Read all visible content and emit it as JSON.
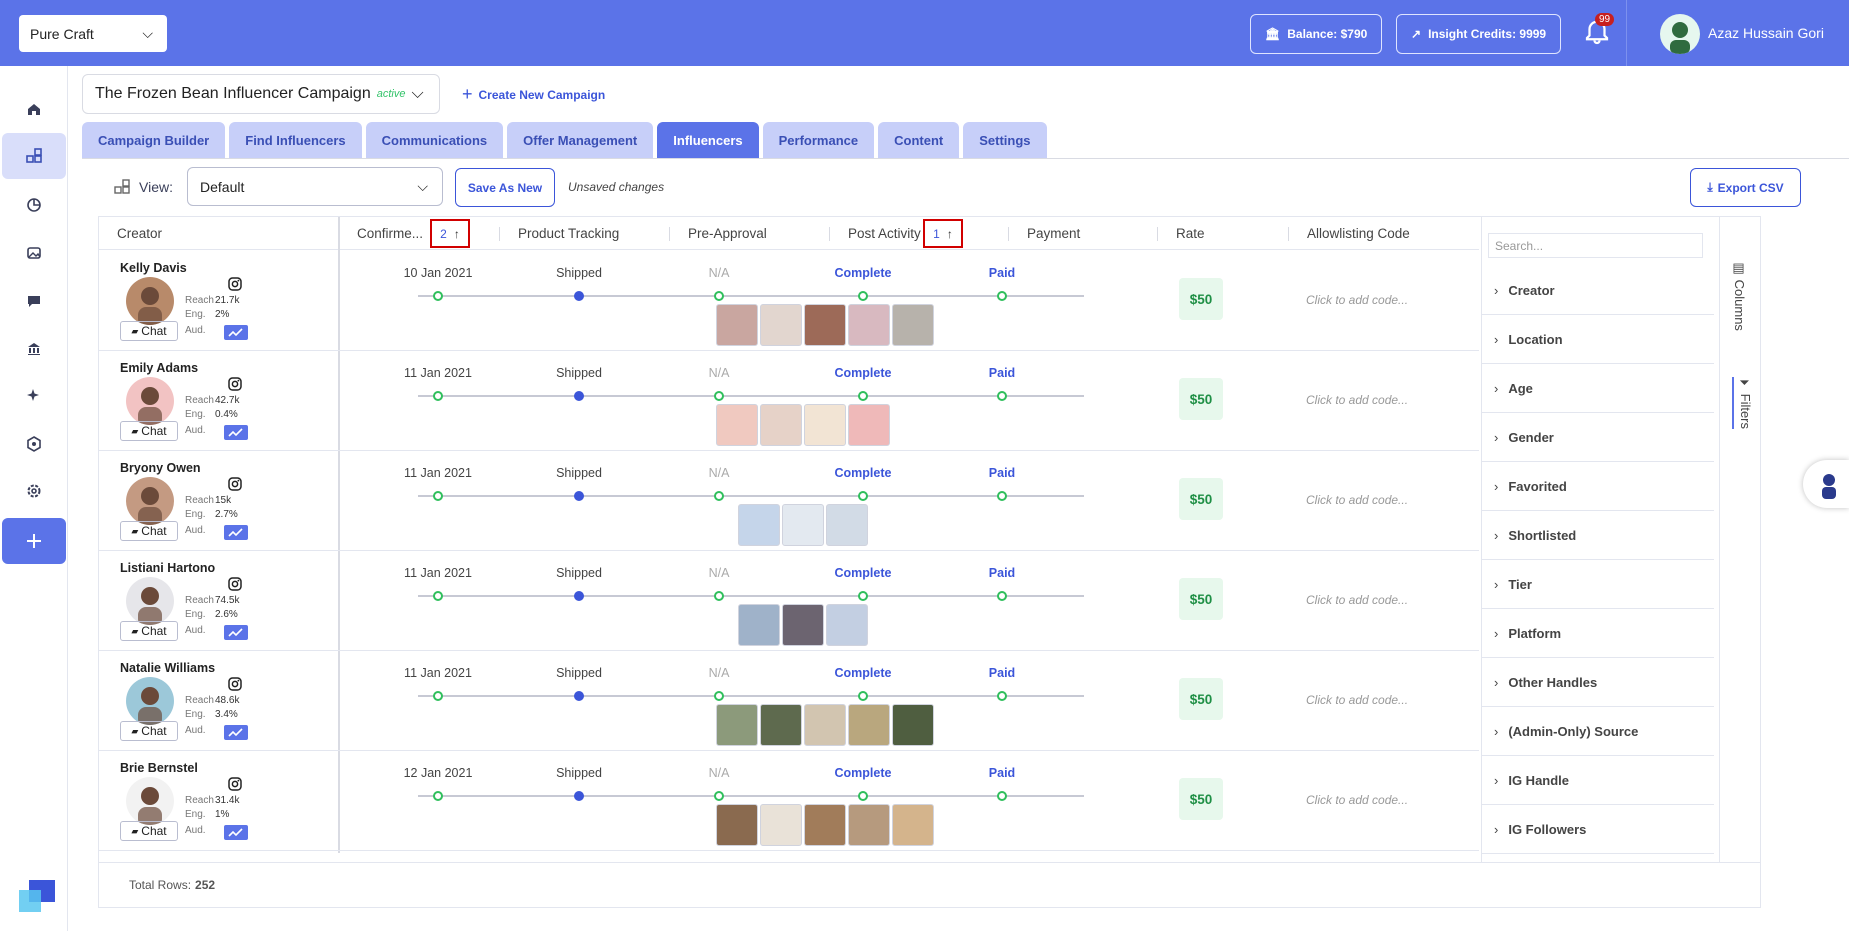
{
  "topbar": {
    "org": "Pure Craft",
    "balance": "Balance: $790",
    "credits": "Insight Credits: 9999",
    "notif_count": "99",
    "user": "Azaz Hussain Gori",
    "color": "#5b73e8"
  },
  "sidebar": {
    "items": [
      "home-icon",
      "dashboard-icon",
      "analytics-icon",
      "media-icon",
      "chat-icon",
      "bank-icon",
      "sparkle-icon",
      "shield-icon",
      "gear-icon",
      "plus-icon"
    ]
  },
  "campaign": {
    "name": "The Frozen Bean Influencer Campaign",
    "status": "active",
    "create_new": "Create New Campaign"
  },
  "tabs": [
    "Campaign Builder",
    "Find Influencers",
    "Communications",
    "Offer Management",
    "Influencers",
    "Performance",
    "Content",
    "Settings"
  ],
  "toolbar": {
    "view_label": "View:",
    "view_value": "Default",
    "save_as_new": "Save As New",
    "unsaved": "Unsaved changes",
    "export": "Export CSV"
  },
  "columns": {
    "creator": "Creator",
    "confirmed": "Confirme...",
    "confirmed_sort": "2",
    "product_tracking": "Product Tracking",
    "pre_approval": "Pre-Approval",
    "post_activity": "Post Activity",
    "post_activity_sort": "1",
    "payment": "Payment",
    "rate": "Rate",
    "allowlisting": "Allowlisting Code"
  },
  "labels": {
    "reach": "Reach",
    "eng": "Eng.",
    "aud": "Aud.",
    "chat": "Chat"
  },
  "rows": [
    {
      "name": "Kelly Davis",
      "reach": "21.7k",
      "eng": "2%",
      "date": "10 Jan 2021",
      "tracking": "Shipped",
      "pre": "N/A",
      "post": "Complete",
      "payment": "Paid",
      "rate": "$50",
      "code": "Click to add code..."
    },
    {
      "name": "Emily Adams",
      "reach": "42.7k",
      "eng": "0.4%",
      "date": "11 Jan 2021",
      "tracking": "Shipped",
      "pre": "N/A",
      "post": "Complete",
      "payment": "Paid",
      "rate": "$50",
      "code": "Click to add code..."
    },
    {
      "name": "Bryony Owen",
      "reach": "15k",
      "eng": "2.7%",
      "date": "11 Jan 2021",
      "tracking": "Shipped",
      "pre": "N/A",
      "post": "Complete",
      "payment": "Paid",
      "rate": "$50",
      "code": "Click to add code..."
    },
    {
      "name": "Listiani Hartono",
      "reach": "74.5k",
      "eng": "2.6%",
      "date": "11 Jan 2021",
      "tracking": "Shipped",
      "pre": "N/A",
      "post": "Complete",
      "payment": "Paid",
      "rate": "$50",
      "code": "Click to add code..."
    },
    {
      "name": "Natalie Williams",
      "reach": "48.6k",
      "eng": "3.4%",
      "date": "11 Jan 2021",
      "tracking": "Shipped",
      "pre": "N/A",
      "post": "Complete",
      "payment": "Paid",
      "rate": "$50",
      "code": "Click to add code..."
    },
    {
      "name": "Brie Bernstel",
      "reach": "31.4k",
      "eng": "1%",
      "date": "12 Jan 2021",
      "tracking": "Shipped",
      "pre": "N/A",
      "post": "Complete",
      "payment": "Paid",
      "rate": "$50",
      "code": "Click to add code..."
    }
  ],
  "footer": {
    "label": "Total Rows:",
    "count": "252"
  },
  "filters": {
    "search_placeholder": "Search...",
    "items": [
      "Creator",
      "Location",
      "Age",
      "Gender",
      "Favorited",
      "Shortlisted",
      "Tier",
      "Platform",
      "Other Handles",
      "(Admin-Only) Source",
      "IG Handle",
      "IG Followers"
    ],
    "columns_tab": "Columns",
    "filters_tab": "Filters"
  }
}
